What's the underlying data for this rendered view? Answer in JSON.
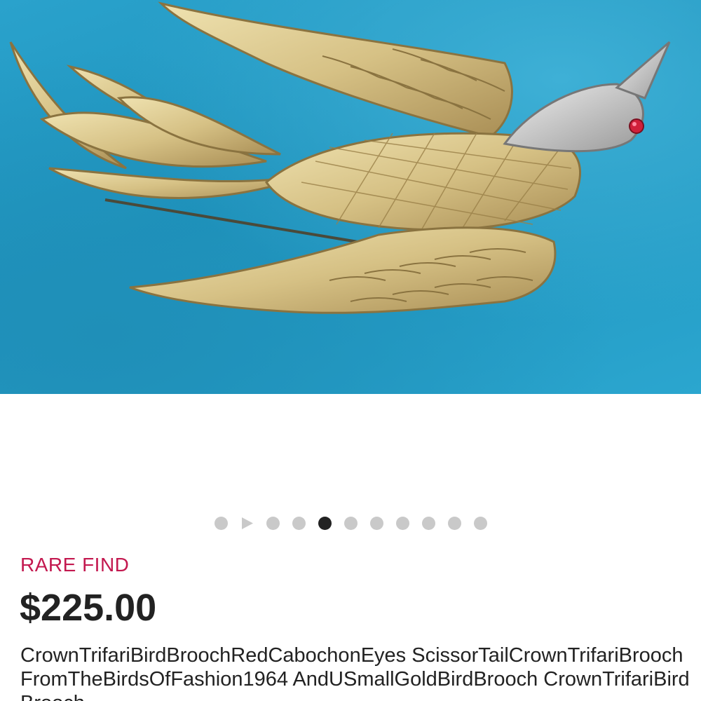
{
  "photo": {
    "alt": "Gold bird brooch with red eye on blue velvet",
    "background_color": "#2aa2cc",
    "subject_color": "#d9c78f"
  },
  "carousel": {
    "total_items": 11,
    "active_index": 4,
    "video_index": 1,
    "dot_color": "#c9c9c9",
    "active_color": "#222222"
  },
  "listing": {
    "badge": "RARE FIND",
    "badge_color": "#c3184f",
    "price": "$225.00",
    "title": "CrownTrifariBirdBroochRedCabochonEyes ScissorTailCrownTrifariBroochFromTheBirdsOfFashion1964 AndUSmallGoldBirdBrooch CrownTrifariBirdBrooch"
  }
}
